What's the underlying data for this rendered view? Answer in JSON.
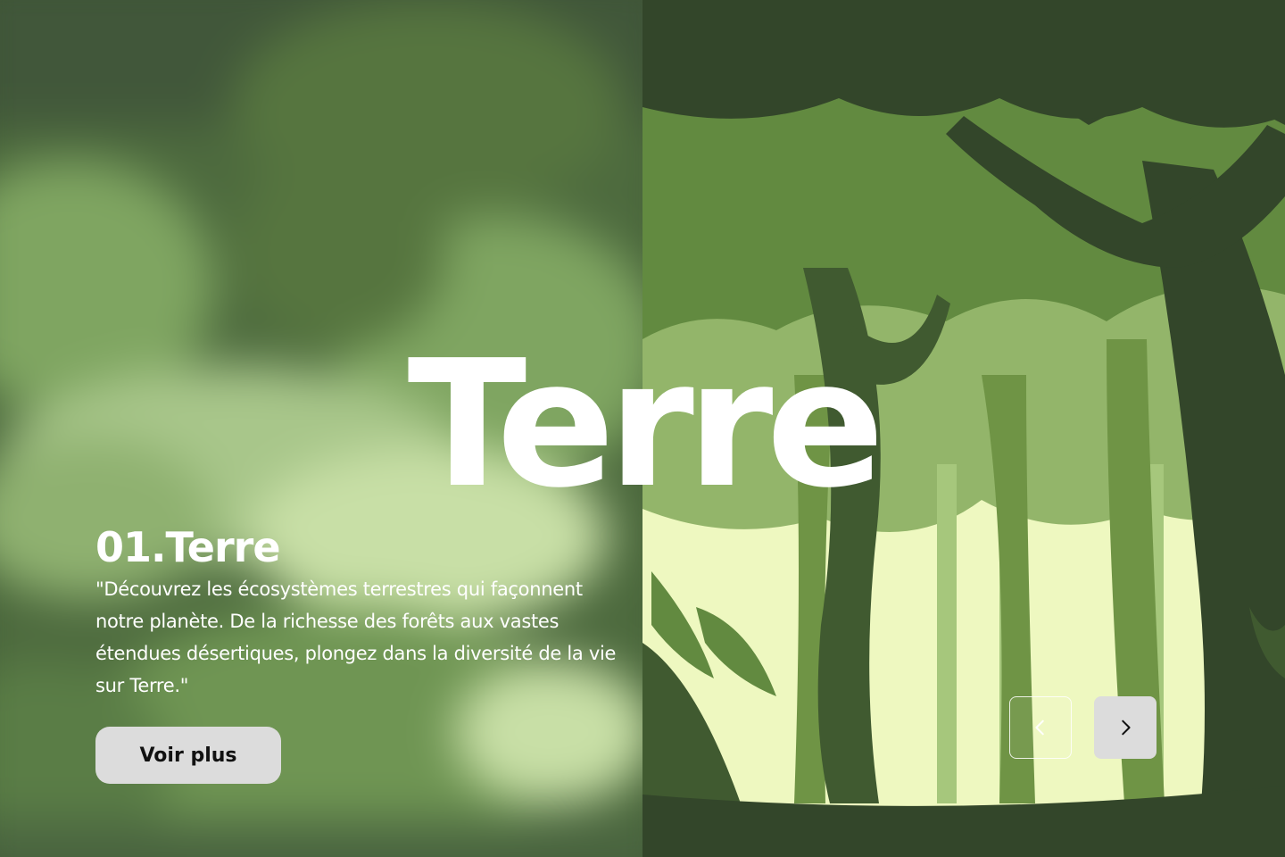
{
  "hero": {
    "title": "Terre"
  },
  "slide": {
    "title": "01.Terre",
    "description": "\"Découvrez les écosystèmes terrestres qui façonnent notre planète. De la richesse des forêts aux vastes étendues désertiques, plongez dans la diversité de la vie sur Terre.\"",
    "button_label": "Voir plus"
  },
  "navigation": {
    "prev_icon": "chevron-left-icon",
    "next_icon": "chevron-right-icon"
  },
  "colors": {
    "background": "#33462a",
    "accent_light": "#eef8c0",
    "button": "#dcdcdc"
  }
}
